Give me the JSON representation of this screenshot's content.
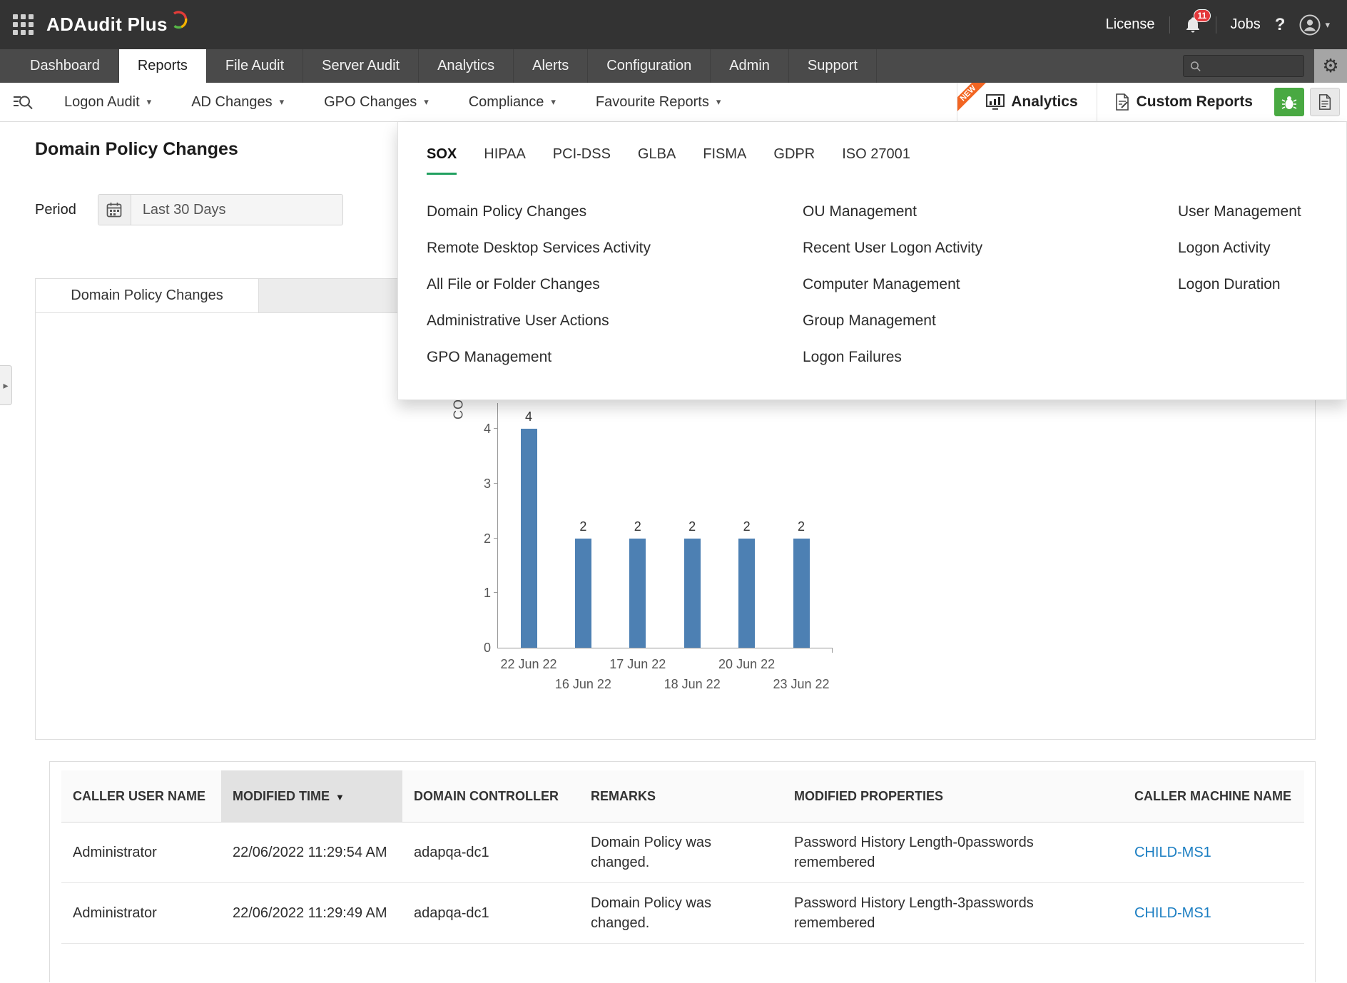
{
  "icons": {
    "chevron_down": "▾",
    "sort_desc": "▼",
    "collapse_arrow": "▸",
    "gear": "⚙"
  },
  "topbar": {
    "logo": "ADAudit Plus",
    "license": "License",
    "notification_count": "11",
    "jobs": "Jobs",
    "help": "?"
  },
  "navbar": {
    "tabs": [
      {
        "label": "Dashboard",
        "active": false
      },
      {
        "label": "Reports",
        "active": true
      },
      {
        "label": "File Audit",
        "active": false
      },
      {
        "label": "Server Audit",
        "active": false
      },
      {
        "label": "Analytics",
        "active": false
      },
      {
        "label": "Alerts",
        "active": false
      },
      {
        "label": "Configuration",
        "active": false
      },
      {
        "label": "Admin",
        "active": false
      },
      {
        "label": "Support",
        "active": false
      }
    ]
  },
  "subnav": {
    "items": [
      {
        "label": "Logon Audit",
        "open": false
      },
      {
        "label": "AD Changes",
        "open": false
      },
      {
        "label": "GPO Changes",
        "open": false
      },
      {
        "label": "Compliance",
        "open": true
      },
      {
        "label": "Favourite Reports",
        "open": false
      }
    ],
    "new_badge": "NEW",
    "analytics": "Analytics",
    "custom_reports": "Custom Reports"
  },
  "page": {
    "title": "Domain Policy Changes",
    "period_label": "Period",
    "period_value": "Last 30 Days",
    "tab": "Domain Policy Changes"
  },
  "dropdown": {
    "tabs": [
      {
        "label": "SOX",
        "active": true
      },
      {
        "label": "HIPAA",
        "active": false
      },
      {
        "label": "PCI-DSS",
        "active": false
      },
      {
        "label": "GLBA",
        "active": false
      },
      {
        "label": "FISMA",
        "active": false
      },
      {
        "label": "GDPR",
        "active": false
      },
      {
        "label": "ISO 27001",
        "active": false
      }
    ],
    "columns": [
      [
        "Domain Policy Changes",
        "Remote Desktop Services Activity",
        "All File or Folder Changes",
        "Administrative User Actions",
        "GPO Management"
      ],
      [
        "OU Management",
        "Recent User Logon Activity",
        "Computer Management",
        "Group Management",
        "Logon Failures"
      ],
      [
        "User Management",
        "Logon Activity",
        "Logon Duration"
      ]
    ]
  },
  "chart_data": {
    "type": "bar",
    "categories": [
      "22 Jun 22",
      "16 Jun 22",
      "17 Jun 22",
      "18 Jun 22",
      "20 Jun 22",
      "23 Jun 22"
    ],
    "values": [
      4,
      2,
      2,
      2,
      2,
      2
    ],
    "title": "",
    "xlabel": "",
    "ylabel": "COUNT",
    "ylim": [
      0,
      4
    ],
    "yticks": [
      0,
      1,
      2,
      3,
      4
    ],
    "bar_color": "#4d80b3",
    "grid": false,
    "legend": "none"
  },
  "table": {
    "headers": [
      "CALLER USER NAME",
      "MODIFIED TIME",
      "DOMAIN CONTROLLER",
      "REMARKS",
      "MODIFIED PROPERTIES",
      "CALLER MACHINE NAME"
    ],
    "sorted_column_index": 1,
    "rows": [
      [
        "Administrator",
        "22/06/2022 11:29:54 AM",
        "adapqa-dc1",
        "Domain Policy was changed.",
        "Password History Length-0passwords remembered",
        "CHILD-MS1"
      ],
      [
        "Administrator",
        "22/06/2022 11:29:49 AM",
        "adapqa-dc1",
        "Domain Policy was changed.",
        "Password History Length-3passwords remembered",
        "CHILD-MS1"
      ]
    ]
  }
}
